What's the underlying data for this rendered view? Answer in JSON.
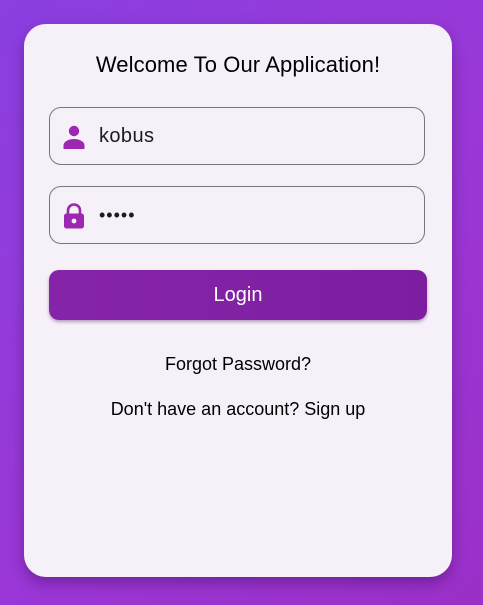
{
  "login_card": {
    "title": "Welcome To Our Application!",
    "username": {
      "value": "kobus",
      "icon": "person-icon"
    },
    "password": {
      "masked_value": "•••••",
      "icon": "lock-icon"
    },
    "login_label": "Login",
    "forgot_password_label": "Forgot Password?",
    "signup_prompt": "Don't have an account? Sign up"
  },
  "colors": {
    "background_gradient": [
      "#8a3fe0",
      "#9b30c8"
    ],
    "card_background": "#f6f0f8",
    "accent": "#8524a8",
    "icon": "#9c27b0",
    "field_border": "#7a747c"
  }
}
